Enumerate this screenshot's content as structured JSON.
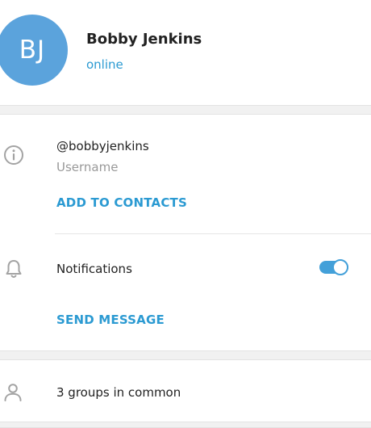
{
  "colors": {
    "accent": "#2b9ad2",
    "avatar_bg": "#5ba3dc",
    "icon_gray": "#a3a3a3",
    "toggle_track": "#43a0d9"
  },
  "profile": {
    "initials": "BJ",
    "name": "Bobby Jenkins",
    "status": "online"
  },
  "info": {
    "icon": "info-icon",
    "username": "@bobbyjenkins",
    "username_caption": "Username",
    "add_to_contacts": "ADD TO CONTACTS"
  },
  "notifications": {
    "icon": "bell-icon",
    "label": "Notifications",
    "enabled": true,
    "send_message": "SEND MESSAGE"
  },
  "groups": {
    "icon": "person-icon",
    "label": "3 groups in common"
  }
}
